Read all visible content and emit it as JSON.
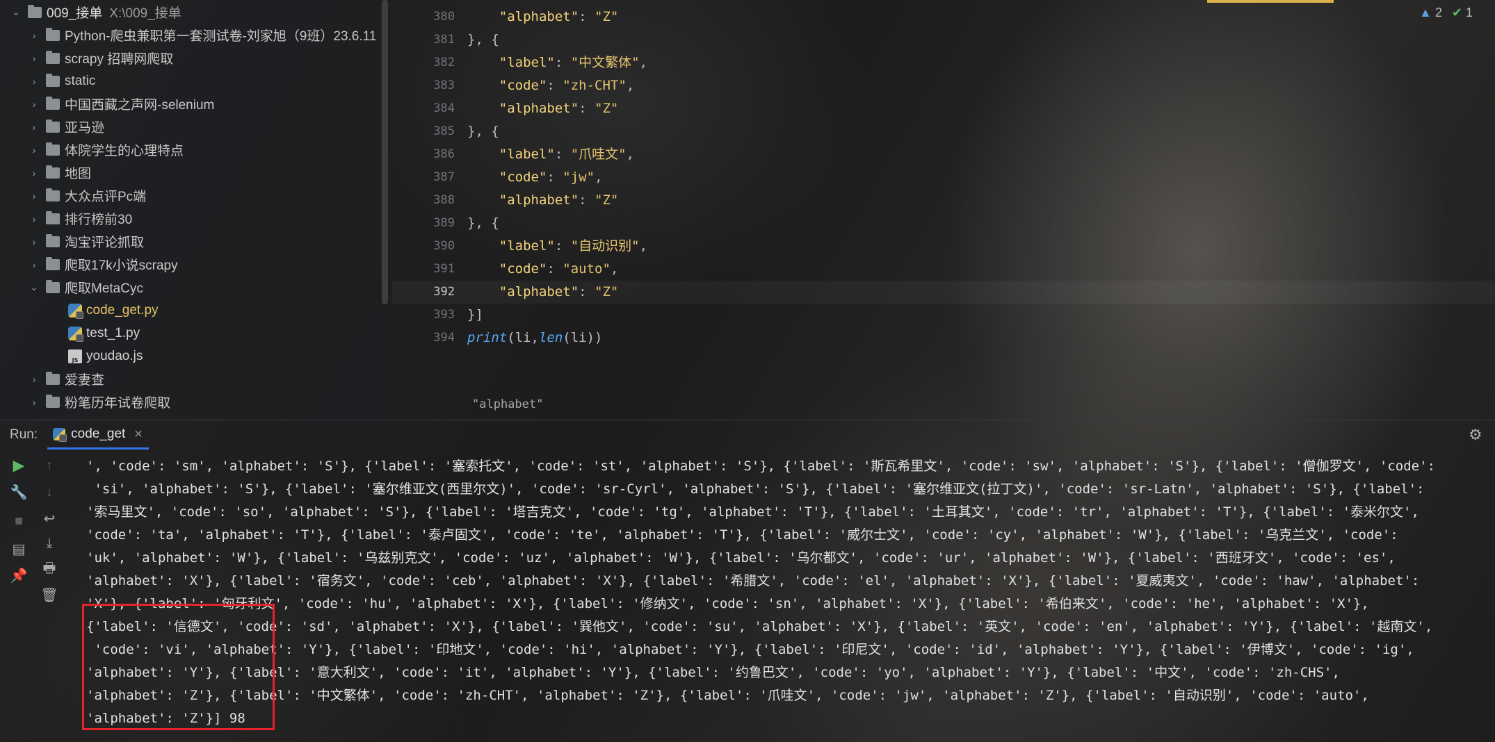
{
  "project_tree": {
    "root": {
      "name": "009_接单",
      "path": "X:\\009_接单"
    },
    "items": [
      {
        "label": "Python-爬虫兼职第一套测试卷-刘家旭（9班）23.6.11",
        "type": "folder",
        "expanded": false
      },
      {
        "label": "scrapy 招聘网爬取",
        "type": "folder",
        "expanded": false
      },
      {
        "label": "static",
        "type": "folder",
        "expanded": false
      },
      {
        "label": "中国西藏之声网-selenium",
        "type": "folder",
        "expanded": false
      },
      {
        "label": "亚马逊",
        "type": "folder",
        "expanded": false
      },
      {
        "label": "体院学生的心理特点",
        "type": "folder",
        "expanded": false
      },
      {
        "label": "地图",
        "type": "folder",
        "expanded": false
      },
      {
        "label": "大众点评Pc端",
        "type": "folder",
        "expanded": false
      },
      {
        "label": "排行榜前30",
        "type": "folder",
        "expanded": false
      },
      {
        "label": "淘宝评论抓取",
        "type": "folder",
        "expanded": false
      },
      {
        "label": "爬取17k小说scrapy",
        "type": "folder",
        "expanded": false
      },
      {
        "label": "爬取MetaCyc",
        "type": "folder",
        "expanded": true
      },
      {
        "label": "code_get.py",
        "type": "py",
        "active": true
      },
      {
        "label": "test_1.py",
        "type": "py"
      },
      {
        "label": "youdao.js",
        "type": "js"
      },
      {
        "label": "爱妻查",
        "type": "folder",
        "expanded": false
      },
      {
        "label": "粉笔历年试卷爬取",
        "type": "folder",
        "expanded": false
      }
    ],
    "js_badge": "JS"
  },
  "editor": {
    "inspections": {
      "warnings": "2",
      "ok": "1",
      "warn_icon": "▲",
      "ok_icon": "✔"
    },
    "current_line": "392",
    "line_numbers": [
      "380",
      "381",
      "382",
      "383",
      "384",
      "385",
      "386",
      "387",
      "388",
      "389",
      "390",
      "391",
      "392",
      "393",
      "394"
    ],
    "breadcrumb": "\"alphabet\""
  },
  "run": {
    "label": "Run:",
    "tab": "code_get",
    "toolbar_icons": [
      "play-icon",
      "wrench-icon",
      "stop-icon",
      "layout-icon",
      "pin-icon",
      "up-arrow-icon",
      "down-arrow-icon",
      "soft-wrap-icon",
      "scroll-to-end-icon",
      "print-icon",
      "trash-icon"
    ],
    "console_lines": [
      "', 'code': 'sm', 'alphabet': 'S'}, {'label': '塞索托文', 'code': 'st', 'alphabet': 'S'}, {'label': '斯瓦希里文', 'code': 'sw', 'alphabet': 'S'}, {'label': '僧伽罗文', 'code':",
      " 'si', 'alphabet': 'S'}, {'label': '塞尔维亚文(西里尔文)', 'code': 'sr-Cyrl', 'alphabet': 'S'}, {'label': '塞尔维亚文(拉丁文)', 'code': 'sr-Latn', 'alphabet': 'S'}, {'label':",
      "'索马里文', 'code': 'so', 'alphabet': 'S'}, {'label': '塔吉克文', 'code': 'tg', 'alphabet': 'T'}, {'label': '土耳其文', 'code': 'tr', 'alphabet': 'T'}, {'label': '泰米尔文',",
      "'code': 'ta', 'alphabet': 'T'}, {'label': '泰卢固文', 'code': 'te', 'alphabet': 'T'}, {'label': '威尔士文', 'code': 'cy', 'alphabet': 'W'}, {'label': '乌克兰文', 'code':",
      "'uk', 'alphabet': 'W'}, {'label': '乌兹别克文', 'code': 'uz', 'alphabet': 'W'}, {'label': '乌尔都文', 'code': 'ur', 'alphabet': 'W'}, {'label': '西班牙文', 'code': 'es',",
      "'alphabet': 'X'}, {'label': '宿务文', 'code': 'ceb', 'alphabet': 'X'}, {'label': '希腊文', 'code': 'el', 'alphabet': 'X'}, {'label': '夏威夷文', 'code': 'haw', 'alphabet':",
      "'X'}, {'label': '匈牙利文', 'code': 'hu', 'alphabet': 'X'}, {'label': '修纳文', 'code': 'sn', 'alphabet': 'X'}, {'label': '希伯来文', 'code': 'he', 'alphabet': 'X'},",
      "{'label': '信德文', 'code': 'sd', 'alphabet': 'X'}, {'label': '巽他文', 'code': 'su', 'alphabet': 'X'}, {'label': '英文', 'code': 'en', 'alphabet': 'Y'}, {'label': '越南文',",
      " 'code': 'vi', 'alphabet': 'Y'}, {'label': '印地文', 'code': 'hi', 'alphabet': 'Y'}, {'label': '印尼文', 'code': 'id', 'alphabet': 'Y'}, {'label': '伊博文', 'code': 'ig',",
      "'alphabet': 'Y'}, {'label': '意大利文', 'code': 'it', 'alphabet': 'Y'}, {'label': '约鲁巴文', 'code': 'yo', 'alphabet': 'Y'}, {'label': '中文', 'code': 'zh-CHS',",
      "'alphabet': 'Z'}, {'label': '中文繁体', 'code': 'zh-CHT', 'alphabet': 'Z'}, {'label': '爪哇文', 'code': 'jw', 'alphabet': 'Z'}, {'label': '自动识别', 'code': 'auto',",
      "'alphabet': 'Z'}] 98"
    ]
  },
  "colors": {
    "accent": "#3574f0",
    "highlight_box": "#e6232b",
    "string": "#6aab73",
    "keyword": "#c77dbb",
    "function": "#56a8f5"
  }
}
